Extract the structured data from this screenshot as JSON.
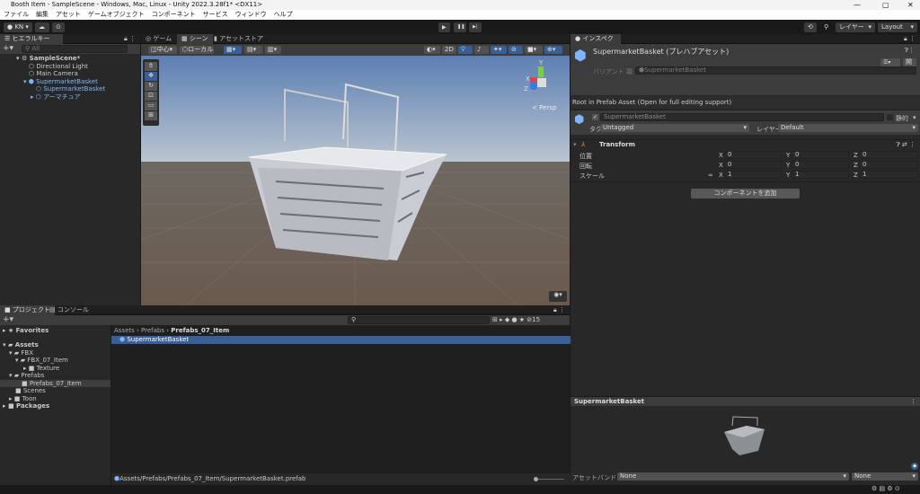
{
  "window": {
    "title": "Booth Item - SampleScene - Windows, Mac, Linux - Unity 2022.3.28f1* <DX11>",
    "min": "—",
    "max": "▢",
    "close": "✕"
  },
  "menu": [
    "ファイル",
    "編集",
    "アセット",
    "ゲームオブジェクト",
    "コンポーネント",
    "サービス",
    "ウィンドウ",
    "ヘルプ"
  ],
  "toolbar": {
    "account": "KN",
    "layers": "レイヤー",
    "layout": "Layout",
    "play": "▶",
    "pause": "❚❚",
    "step": "▶|"
  },
  "hierarchy": {
    "tab": "ヒエラルキー",
    "search_placeholder": "All",
    "items": [
      {
        "label": "SampleScene*",
        "blue": false,
        "bold": true
      },
      {
        "label": "Directional Light",
        "blue": false
      },
      {
        "label": "Main Camera",
        "blue": false
      },
      {
        "label": "SupermarketBasket",
        "blue": true
      },
      {
        "label": "SupermarketBasket",
        "blue": true
      },
      {
        "label": "アーマチュア",
        "blue": true
      }
    ]
  },
  "scene": {
    "tabs": [
      "ゲーム",
      "シーン",
      "アセットストア"
    ],
    "pivot": "中心",
    "space": "ローカル",
    "mode2d": "2D",
    "persp": "< Persp",
    "gizmo_axes": [
      "Y",
      "X",
      "Z"
    ]
  },
  "project": {
    "tabs": [
      "プロジェクト",
      "コンソール"
    ],
    "hidden_count": "15",
    "tree": [
      {
        "label": "Favorites",
        "bold": true
      },
      {
        "label": "Assets",
        "bold": true
      },
      {
        "label": "FBX"
      },
      {
        "label": "FBX_07_Item"
      },
      {
        "label": "Texture"
      },
      {
        "label": "Prefabs"
      },
      {
        "label": "Prefabs_07_Item",
        "selected": true
      },
      {
        "label": "Scenes"
      },
      {
        "label": "Toon"
      },
      {
        "label": "Packages",
        "bold": true
      }
    ],
    "breadcrumb": [
      "Assets",
      "Prefabs",
      "Prefabs_07_Item"
    ],
    "assets": [
      "SupermarketBasket"
    ],
    "path": "Assets/Prefabs/Prefabs_07_Item/SupermarketBasket.prefab"
  },
  "inspector": {
    "tab": "インスペクター",
    "title": "SupermarketBasket (プレハブアセット)",
    "open": "開く",
    "variant_label": "バリアント 親",
    "variant_value": "SupermarketBasket",
    "root_note": "Root in Prefab Asset (Open for full editing support)",
    "object_name": "SupermarketBasket",
    "static": "静的",
    "tag_label": "タグ",
    "tag": "Untagged",
    "layer_label": "レイヤー",
    "layer": "Default",
    "transform": {
      "title": "Transform",
      "rows": [
        {
          "label": "位置",
          "x": "0",
          "y": "0",
          "z": "0"
        },
        {
          "label": "回転",
          "x": "0",
          "y": "0",
          "z": "0"
        },
        {
          "label": "スケール",
          "x": "1",
          "y": "1",
          "z": "1"
        }
      ]
    },
    "add_component": "コンポーネントを追加",
    "preview_title": "SupermarketBasket",
    "bundle_label": "アセットバンドル",
    "bundle": "None",
    "variant": "None"
  },
  "colors": {
    "selection": "#3a5e96",
    "accent_blue": "#7fb5ff"
  }
}
